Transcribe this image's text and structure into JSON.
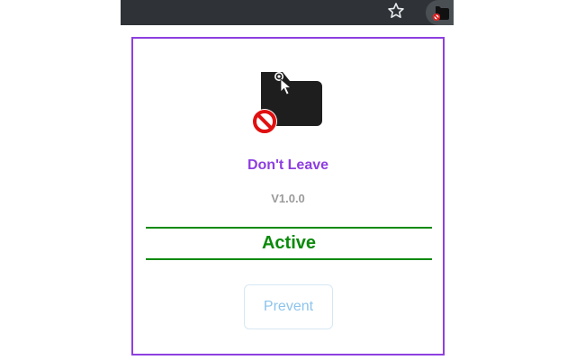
{
  "browser": {
    "star_icon": "star-outline-icon",
    "extension_icon": "dont-leave-extension-icon"
  },
  "popup": {
    "app_name": "Don't Leave",
    "version": "V1.0.0",
    "status": "Active",
    "prevent_label": "Prevent",
    "logo_icon": "folder-cursor-blocked-icon",
    "colors": {
      "accent": "#8e3ee0",
      "status": "#0a8a0a",
      "version": "#9a9a9a",
      "button_text": "#8cc4ec",
      "block": "#e01010"
    }
  }
}
